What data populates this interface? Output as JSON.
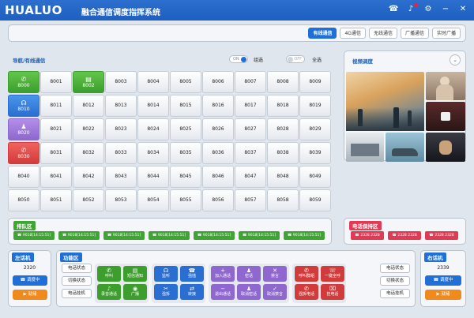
{
  "app": {
    "logo": "HUALUO",
    "title": "融合通信调度指挥系统"
  },
  "titlebar_icons": [
    "phone-icon",
    "bell-icon",
    "gear-icon",
    "minimize-icon",
    "close-icon"
  ],
  "tabs": [
    {
      "label": "有线通信",
      "active": true
    },
    {
      "label": "4G通信",
      "active": false
    },
    {
      "label": "无线通信",
      "active": false
    },
    {
      "label": "广播通信",
      "active": false
    },
    {
      "label": "实时广播",
      "active": false
    }
  ],
  "grid_section": {
    "title": "导航/有线通信",
    "toggle1_label": "ON",
    "toggle1_text": "组选",
    "toggle2_label": "OFF",
    "toggle2_text": "全选"
  },
  "extensions": [
    [
      "8000",
      "8001",
      "8002",
      "8003",
      "8004",
      "8005",
      "8006",
      "8007",
      "8008",
      "8009"
    ],
    [
      "8010",
      "8011",
      "8012",
      "8013",
      "8014",
      "8015",
      "8016",
      "8017",
      "8018",
      "8019"
    ],
    [
      "8020",
      "8021",
      "8022",
      "8023",
      "8024",
      "8025",
      "8026",
      "8027",
      "8028",
      "8029"
    ],
    [
      "8030",
      "8031",
      "8032",
      "8033",
      "8034",
      "8035",
      "8036",
      "8037",
      "8038",
      "8039"
    ],
    [
      "8040",
      "8041",
      "8042",
      "8043",
      "8044",
      "8045",
      "8046",
      "8047",
      "8048",
      "8049"
    ],
    [
      "8050",
      "8051",
      "8052",
      "8053",
      "8054",
      "8055",
      "8056",
      "8057",
      "8058",
      "8059"
    ]
  ],
  "colored_cells": {
    "8000": {
      "color": "g",
      "icon": "✆"
    },
    "8002": {
      "color": "g",
      "icon": "▤"
    },
    "8010": {
      "color": "b",
      "icon": "☊"
    },
    "8020": {
      "color": "p",
      "icon": "♟"
    },
    "8030": {
      "color": "r",
      "icon": "✆"
    }
  },
  "video": {
    "title": "视频调度"
  },
  "queue": {
    "title": "排队区",
    "items": [
      "9018[14:15:51]",
      "9018[14:15:51]",
      "9018[14:15:51]",
      "9018[14:15:51]",
      "9018[14:15:51]",
      "9018[14:15:51]",
      "9018[14:15:51]"
    ]
  },
  "hold": {
    "title": "电话保持区",
    "items": [
      "2328 2328",
      "2328 2328",
      "2328 2328"
    ]
  },
  "left_phone": {
    "title": "左话机",
    "number": "2320",
    "mute_label": "调度中",
    "answer_label": "就绪"
  },
  "right_phone": {
    "title": "右话机",
    "number": "2339",
    "mute_label": "调度中",
    "answer_label": "就绪"
  },
  "func": {
    "title": "功能区",
    "left_buttons": [
      "电话状态",
      "切换状态",
      "电话挂机"
    ],
    "right_buttons": [
      "电话状态",
      "切换状态",
      "电话挂机"
    ],
    "green_group": [
      {
        "label": "呼叫",
        "icon": "✆"
      },
      {
        "label": "短信通知",
        "icon": "▤"
      },
      {
        "label": "录音通话",
        "icon": "♪"
      },
      {
        "label": "广播",
        "icon": "◉"
      }
    ],
    "blue_group": [
      {
        "label": "监听",
        "icon": "☊"
      },
      {
        "label": "强插",
        "icon": "☎"
      },
      {
        "label": "强拆",
        "icon": "✂"
      },
      {
        "label": "转接",
        "icon": "⇄"
      }
    ],
    "purple_group": [
      {
        "label": "加入通话",
        "icon": "+"
      },
      {
        "label": "密话",
        "icon": "♟"
      },
      {
        "label": "禁言",
        "icon": "✕"
      },
      {
        "label": "退出通话",
        "icon": "−"
      },
      {
        "label": "取消密话",
        "icon": "♟"
      },
      {
        "label": "取消禁言",
        "icon": "✓"
      }
    ],
    "red_group": [
      {
        "label": "呼叫群组",
        "icon": "✆"
      },
      {
        "label": "一键全呼",
        "icon": "☏"
      },
      {
        "label": "强拆电话",
        "icon": "✆"
      },
      {
        "label": "挂电话",
        "icon": "⌧"
      }
    ]
  },
  "colors": {
    "titlebar": "#1e5fbf",
    "green": "#3d9e2d",
    "blue": "#2a6ed1",
    "purple": "#8e67cf",
    "red": "#d23b3b",
    "queue": "#3fa532",
    "hold": "#e03a55"
  }
}
